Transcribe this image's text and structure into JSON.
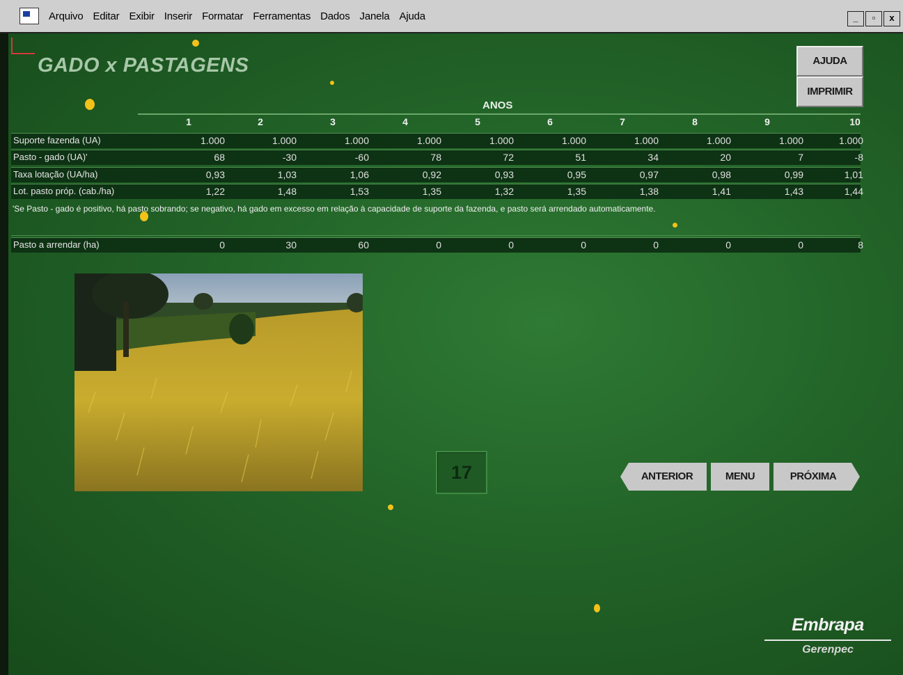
{
  "menubar": {
    "items": [
      "Arquivo",
      "Editar",
      "Exibir",
      "Inserir",
      "Formatar",
      "Ferramentas",
      "Dados",
      "Janela",
      "Ajuda"
    ],
    "window_controls": [
      "_",
      "▫",
      "x"
    ]
  },
  "title": "GADO x PASTAGENS",
  "buttons": {
    "ajuda": "AJUDA",
    "imprimir": "IMPRIMIR",
    "anterior": "ANTERIOR",
    "menu": "MENU",
    "proxima": "PRÓXIMA"
  },
  "table": {
    "anos_label": "ANOS",
    "years": [
      "1",
      "2",
      "3",
      "4",
      "5",
      "6",
      "7",
      "8",
      "9",
      "10"
    ],
    "rows": [
      {
        "label": "Suporte fazenda (UA)",
        "values": [
          "1.000",
          "1.000",
          "1.000",
          "1.000",
          "1.000",
          "1.000",
          "1.000",
          "1.000",
          "1.000",
          "1.000"
        ]
      },
      {
        "label": "Pasto - gado (UA)'",
        "values": [
          "68",
          "-30",
          "-60",
          "78",
          "72",
          "51",
          "34",
          "20",
          "7",
          "-8"
        ]
      },
      {
        "label": "Taxa lotação (UA/ha)",
        "values": [
          "0,93",
          "1,03",
          "1,06",
          "0,92",
          "0,93",
          "0,95",
          "0,97",
          "0,98",
          "0,99",
          "1,01"
        ]
      },
      {
        "label": "Lot. pasto próp. (cab./ha)",
        "values": [
          "1,22",
          "1,48",
          "1,53",
          "1,35",
          "1,32",
          "1,35",
          "1,38",
          "1,41",
          "1,43",
          "1,44"
        ]
      }
    ],
    "note": "'Se Pasto - gado é positivo, há pasto sobrando; se negativo, há gado em excesso em relação à capacidade de suporte da fazenda, e pasto será arrendado automaticamente.",
    "arrendar": {
      "label": "Pasto a arrendar (ha)",
      "values": [
        "0",
        "30",
        "60",
        "0",
        "0",
        "0",
        "0",
        "0",
        "0",
        "8"
      ]
    }
  },
  "page_number": "17",
  "logo": {
    "name": "Embrapa",
    "sub": "Gerenpec"
  },
  "colors": {
    "background": "#226328",
    "button": "#c8c8c8",
    "table_row": "#0e3214",
    "title": "#a8c7a8"
  },
  "photo": {
    "icon": "pasture-photo"
  }
}
